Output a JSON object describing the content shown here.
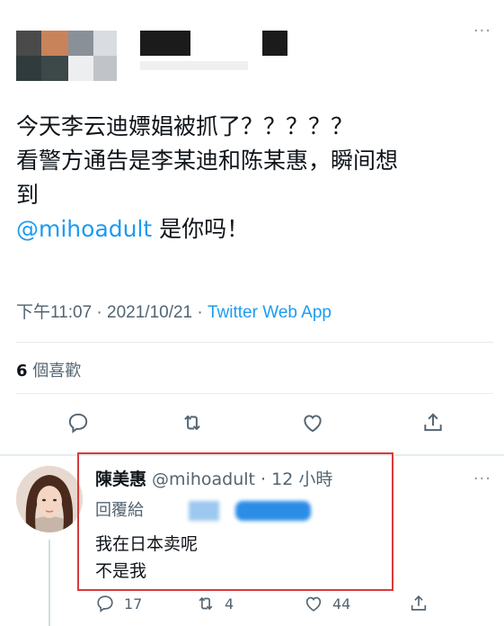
{
  "top_tweet": {
    "more_label": "···",
    "text_lines": [
      "今天李云迪嫖娼被抓了？？？？？",
      "看警方通告是李某迪和陈某惠，瞬间想",
      "到"
    ],
    "mention": "@mihoadult",
    "mention_suffix": " 是你吗！",
    "timestamp": "下午11:07 · 2021/10/21 · ",
    "source_app": "Twitter Web App",
    "like_count": "6",
    "like_label": " 個喜歡"
  },
  "icons": {
    "reply": "reply-icon",
    "retweet": "retweet-icon",
    "like": "like-icon",
    "share": "share-icon",
    "more": "more-icon"
  },
  "reply": {
    "display_name": "陳美惠",
    "handle_time": " @mihoadult · 12 小時",
    "replying_to_label": "回覆給",
    "text_lines": [
      "我在日本卖呢",
      "不是我"
    ],
    "reply_count": "17",
    "retweet_count": "4",
    "like_count": "44",
    "more_label": "···"
  },
  "colors": {
    "accent": "#1d9bf0",
    "highlight_border": "#d93a3a",
    "secondary_text": "#536471"
  }
}
